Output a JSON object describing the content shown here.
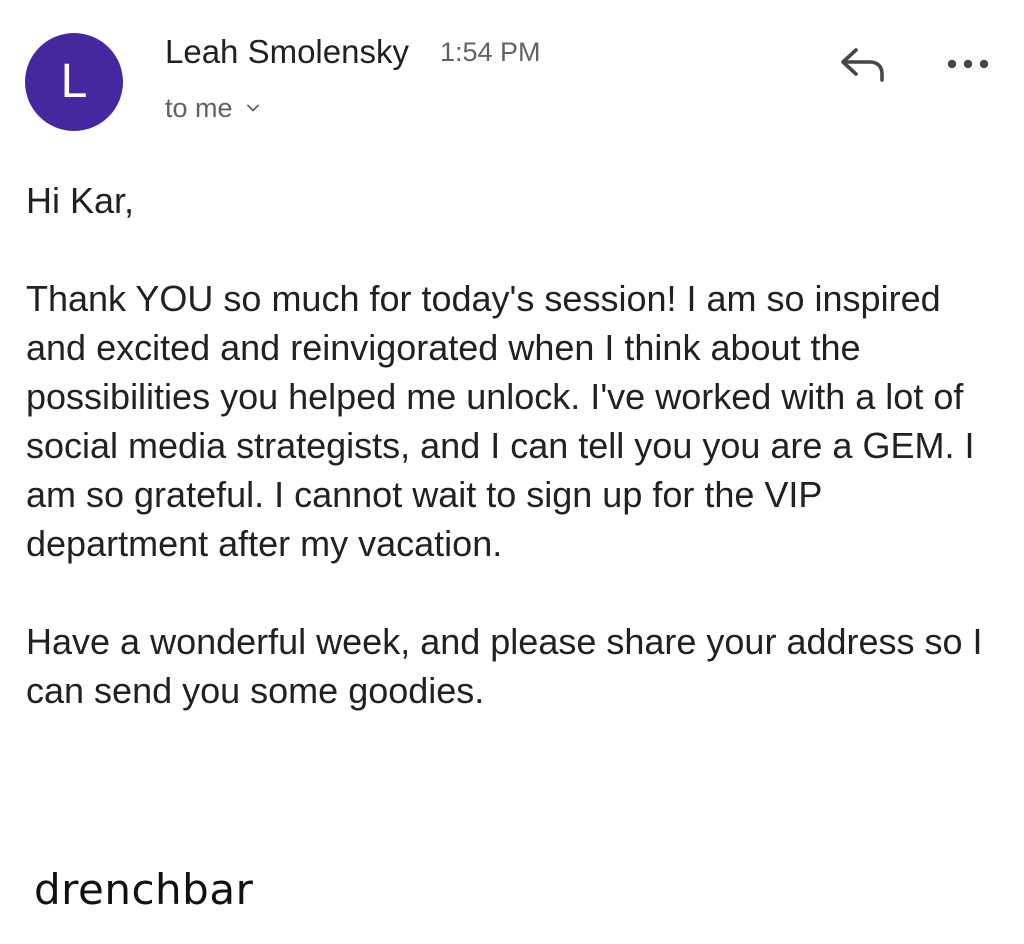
{
  "email": {
    "avatar_letter": "L",
    "avatar_color": "#4527a0",
    "sender_name": "Leah Smolensky",
    "time": "1:54 PM",
    "recipient": "to me",
    "icons": [
      "chevron-down-icon",
      "reply-icon",
      "more-icon"
    ],
    "body": {
      "greeting": "Hi Kar,",
      "paragraph_1": "Thank YOU so much for today's session! I am so inspired and excited and reinvigorated when I think about the possibilities you helped me unlock. I've worked with a lot of social media strategists, and I can tell you you are a GEM. I am so grateful. I cannot wait to sign up for the VIP department after my vacation.",
      "paragraph_2": "Have a wonderful week, and please share your address so I can send you some goodies."
    }
  },
  "footer": {
    "logo_text": "drenchbar"
  }
}
